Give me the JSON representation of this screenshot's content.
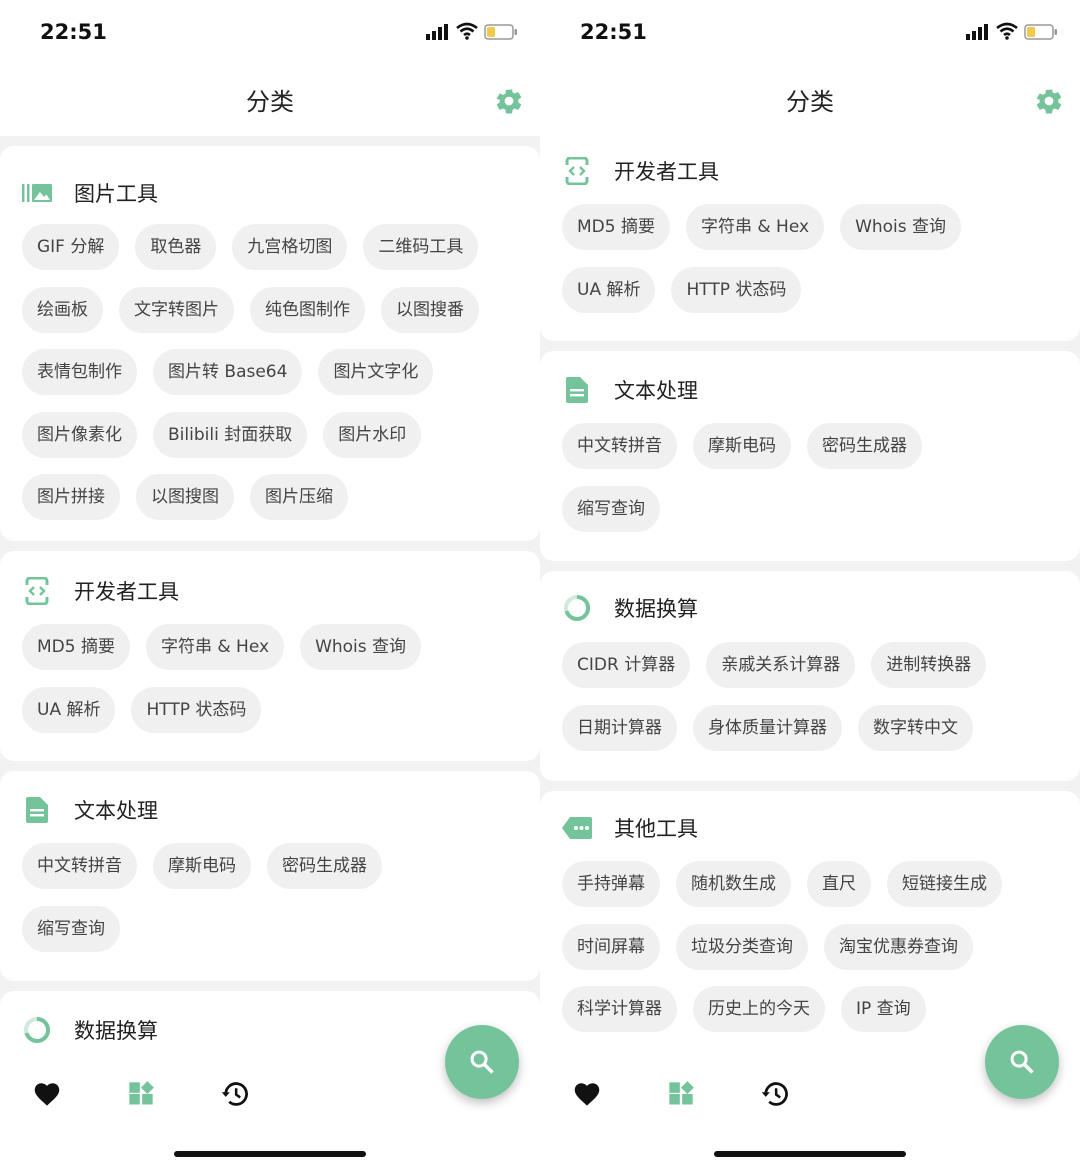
{
  "colors": {
    "accent": "#74c39b",
    "chip_bg": "#f0f0f0",
    "page_bg": "#f2f2f2",
    "text": "#222222"
  },
  "status_bar": {
    "time": "22:51"
  },
  "header": {
    "title": "分类"
  },
  "left": {
    "cards": [
      {
        "title": "图片工具",
        "icon": "image-tools-icon",
        "rows": [
          [
            "GIF 分解",
            "取色器",
            "九宫格切图",
            "二维码工具"
          ],
          [
            "绘画板",
            "文字转图片",
            "纯色图制作",
            "以图搜番"
          ],
          [
            "表情包制作",
            "图片转 Base64",
            "图片文字化"
          ],
          [
            "图片像素化",
            "Bilibili 封面获取",
            "图片水印"
          ],
          [
            "图片拼接",
            "以图搜图",
            "图片压缩"
          ]
        ]
      },
      {
        "title": "开发者工具",
        "icon": "code-icon",
        "rows": [
          [
            "MD5 摘要",
            "字符串 & Hex",
            "Whois 查询"
          ],
          [
            "UA 解析",
            "HTTP 状态码"
          ]
        ]
      },
      {
        "title": "文本处理",
        "icon": "document-icon",
        "rows": [
          [
            "中文转拼音",
            "摩斯电码",
            "密码生成器"
          ],
          [
            "缩写查询"
          ]
        ]
      },
      {
        "title": "数据换算",
        "icon": "ring-chart-icon",
        "rows": []
      }
    ]
  },
  "right": {
    "cards": [
      {
        "title": "开发者工具",
        "icon": "code-icon",
        "rows": [
          [
            "MD5 摘要",
            "字符串 & Hex",
            "Whois 查询"
          ],
          [
            "UA 解析",
            "HTTP 状态码"
          ]
        ]
      },
      {
        "title": "文本处理",
        "icon": "document-icon",
        "rows": [
          [
            "中文转拼音",
            "摩斯电码",
            "密码生成器"
          ],
          [
            "缩写查询"
          ]
        ]
      },
      {
        "title": "数据换算",
        "icon": "ring-chart-icon",
        "rows": [
          [
            "CIDR 计算器",
            "亲戚关系计算器",
            "进制转换器"
          ],
          [
            "日期计算器",
            "身体质量计算器",
            "数字转中文"
          ]
        ]
      },
      {
        "title": "其他工具",
        "icon": "more-tag-icon",
        "rows": [
          [
            "手持弹幕",
            "随机数生成",
            "直尺",
            "短链接生成"
          ],
          [
            "时间屏幕",
            "垃圾分类查询",
            "淘宝优惠券查询"
          ],
          [
            "科学计算器",
            "历史上的今天",
            "IP 查询"
          ]
        ]
      }
    ]
  },
  "bottom_nav": [
    {
      "name": "favorites",
      "icon": "heart-icon"
    },
    {
      "name": "categories",
      "icon": "widgets-icon"
    },
    {
      "name": "history",
      "icon": "history-icon"
    }
  ]
}
